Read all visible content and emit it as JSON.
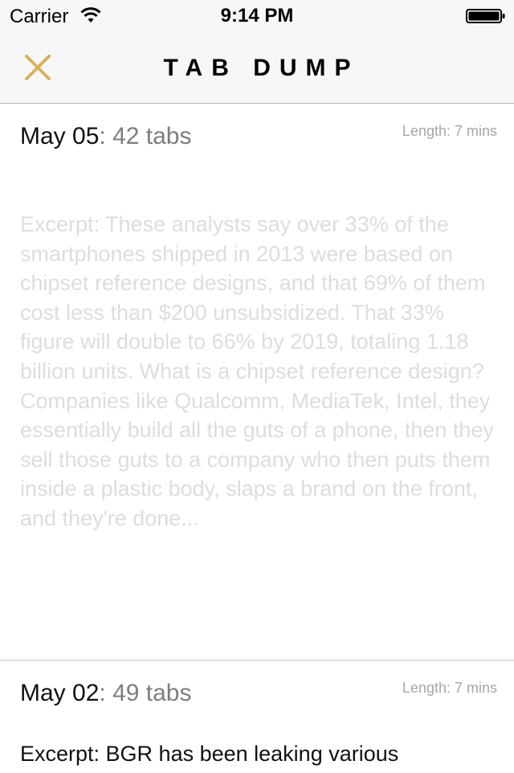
{
  "status_bar": {
    "carrier": "Carrier",
    "time": "9:14 PM"
  },
  "nav": {
    "title": "TAB DUMP",
    "close_icon": "close-x-icon",
    "accent_color": "#d9b15c"
  },
  "entries": [
    {
      "date": "May 05",
      "separator": ": ",
      "tabs": "42 tabs",
      "length": "Length: 7 mins",
      "excerpt": "Excerpt: These analysts say over 33% of the smartphones shipped in 2013 were based on chipset reference designs, and that 69% of them cost less than $200 unsubsidized. That 33% figure will double to 66% by 2019, totaling 1.18 billion units. What is a chipset reference design? Companies like Qualcomm, MediaTek, Intel, they essentially build all the guts of a phone, then they sell those guts to a company who then puts them inside a plastic body, slaps a brand on the front, and they're done..."
    },
    {
      "date": "May 02",
      "separator": ": ",
      "tabs": "49 tabs",
      "length": "Length: 7 mins",
      "excerpt": "Excerpt: BGR has been leaking various"
    }
  ]
}
